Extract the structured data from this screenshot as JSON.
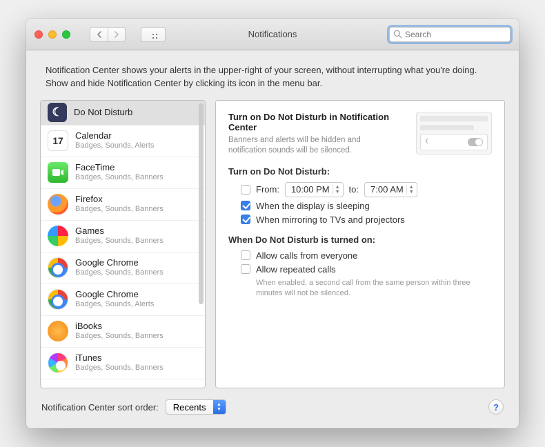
{
  "window": {
    "title": "Notifications"
  },
  "search": {
    "placeholder": "Search",
    "value": ""
  },
  "intro": "Notification Center shows your alerts in the upper-right of your screen, without interrupting what you're doing. Show and hide Notification Center by clicking its icon in the menu bar.",
  "apps": [
    {
      "name": "Do Not Disturb",
      "sub": "",
      "selected": true,
      "icon": "dnd"
    },
    {
      "name": "Calendar",
      "sub": "Badges, Sounds, Alerts",
      "icon": "cal",
      "calDay": "17"
    },
    {
      "name": "FaceTime",
      "sub": "Badges, Sounds, Banners",
      "icon": "ft"
    },
    {
      "name": "Firefox",
      "sub": "Badges, Sounds, Banners",
      "icon": "ff"
    },
    {
      "name": "Games",
      "sub": "Badges, Sounds, Banners",
      "icon": "gm"
    },
    {
      "name": "Google Chrome",
      "sub": "Badges, Sounds, Banners",
      "icon": "gc"
    },
    {
      "name": "Google Chrome",
      "sub": "Badges, Sounds, Alerts",
      "icon": "gc"
    },
    {
      "name": "iBooks",
      "sub": "Badges, Sounds, Banners",
      "icon": "ib"
    },
    {
      "name": "iTunes",
      "sub": "Badges, Sounds, Banners",
      "icon": "it"
    }
  ],
  "detail": {
    "title": "Turn on Do Not Disturb in Notification Center",
    "sub": "Banners and alerts will be hidden and notification sounds will be silenced.",
    "turnOnHeader": "Turn on Do Not Disturb:",
    "fromLabel": "From:",
    "fromTime": "10:00 PM",
    "toLabel": "to:",
    "toTime": "7:00 AM",
    "fromChecked": false,
    "sleepLabel": "When the display is sleeping",
    "sleepChecked": true,
    "mirrorLabel": "When mirroring to TVs and projectors",
    "mirrorChecked": true,
    "whenOnHeader": "When Do Not Disturb is turned on:",
    "allowEveryoneLabel": "Allow calls from everyone",
    "allowEveryoneChecked": false,
    "allowRepeatedLabel": "Allow repeated calls",
    "allowRepeatedChecked": false,
    "repeatedHelp": "When enabled, a second call from the same person within three minutes will not be silenced."
  },
  "footer": {
    "label": "Notification Center sort order:",
    "value": "Recents"
  }
}
